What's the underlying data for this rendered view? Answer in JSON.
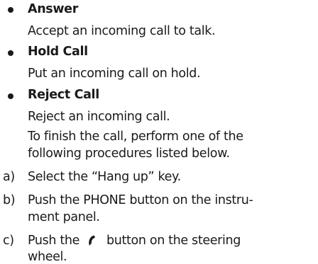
{
  "items": [
    {
      "title": "Answer",
      "desc": [
        "Accept an incoming call to talk."
      ]
    },
    {
      "title": "Hold Call",
      "desc": [
        "Put an incoming call on hold."
      ]
    },
    {
      "title": "Reject Call",
      "desc": [
        "Reject an incoming call."
      ]
    }
  ],
  "finish": {
    "line1": "To finish the call, perform one of the",
    "line2": "following procedures listed below."
  },
  "steps": [
    {
      "marker": "a)",
      "lines": [
        "Select the “Hang up” key."
      ]
    },
    {
      "marker": "b)",
      "lines": [
        "Push the PHONE button on the instru-",
        "ment panel."
      ]
    },
    {
      "marker": "c)",
      "before": "Push the",
      "icon": "phone-handset-icon",
      "after": "button on the steering",
      "line2": "wheel."
    }
  ]
}
